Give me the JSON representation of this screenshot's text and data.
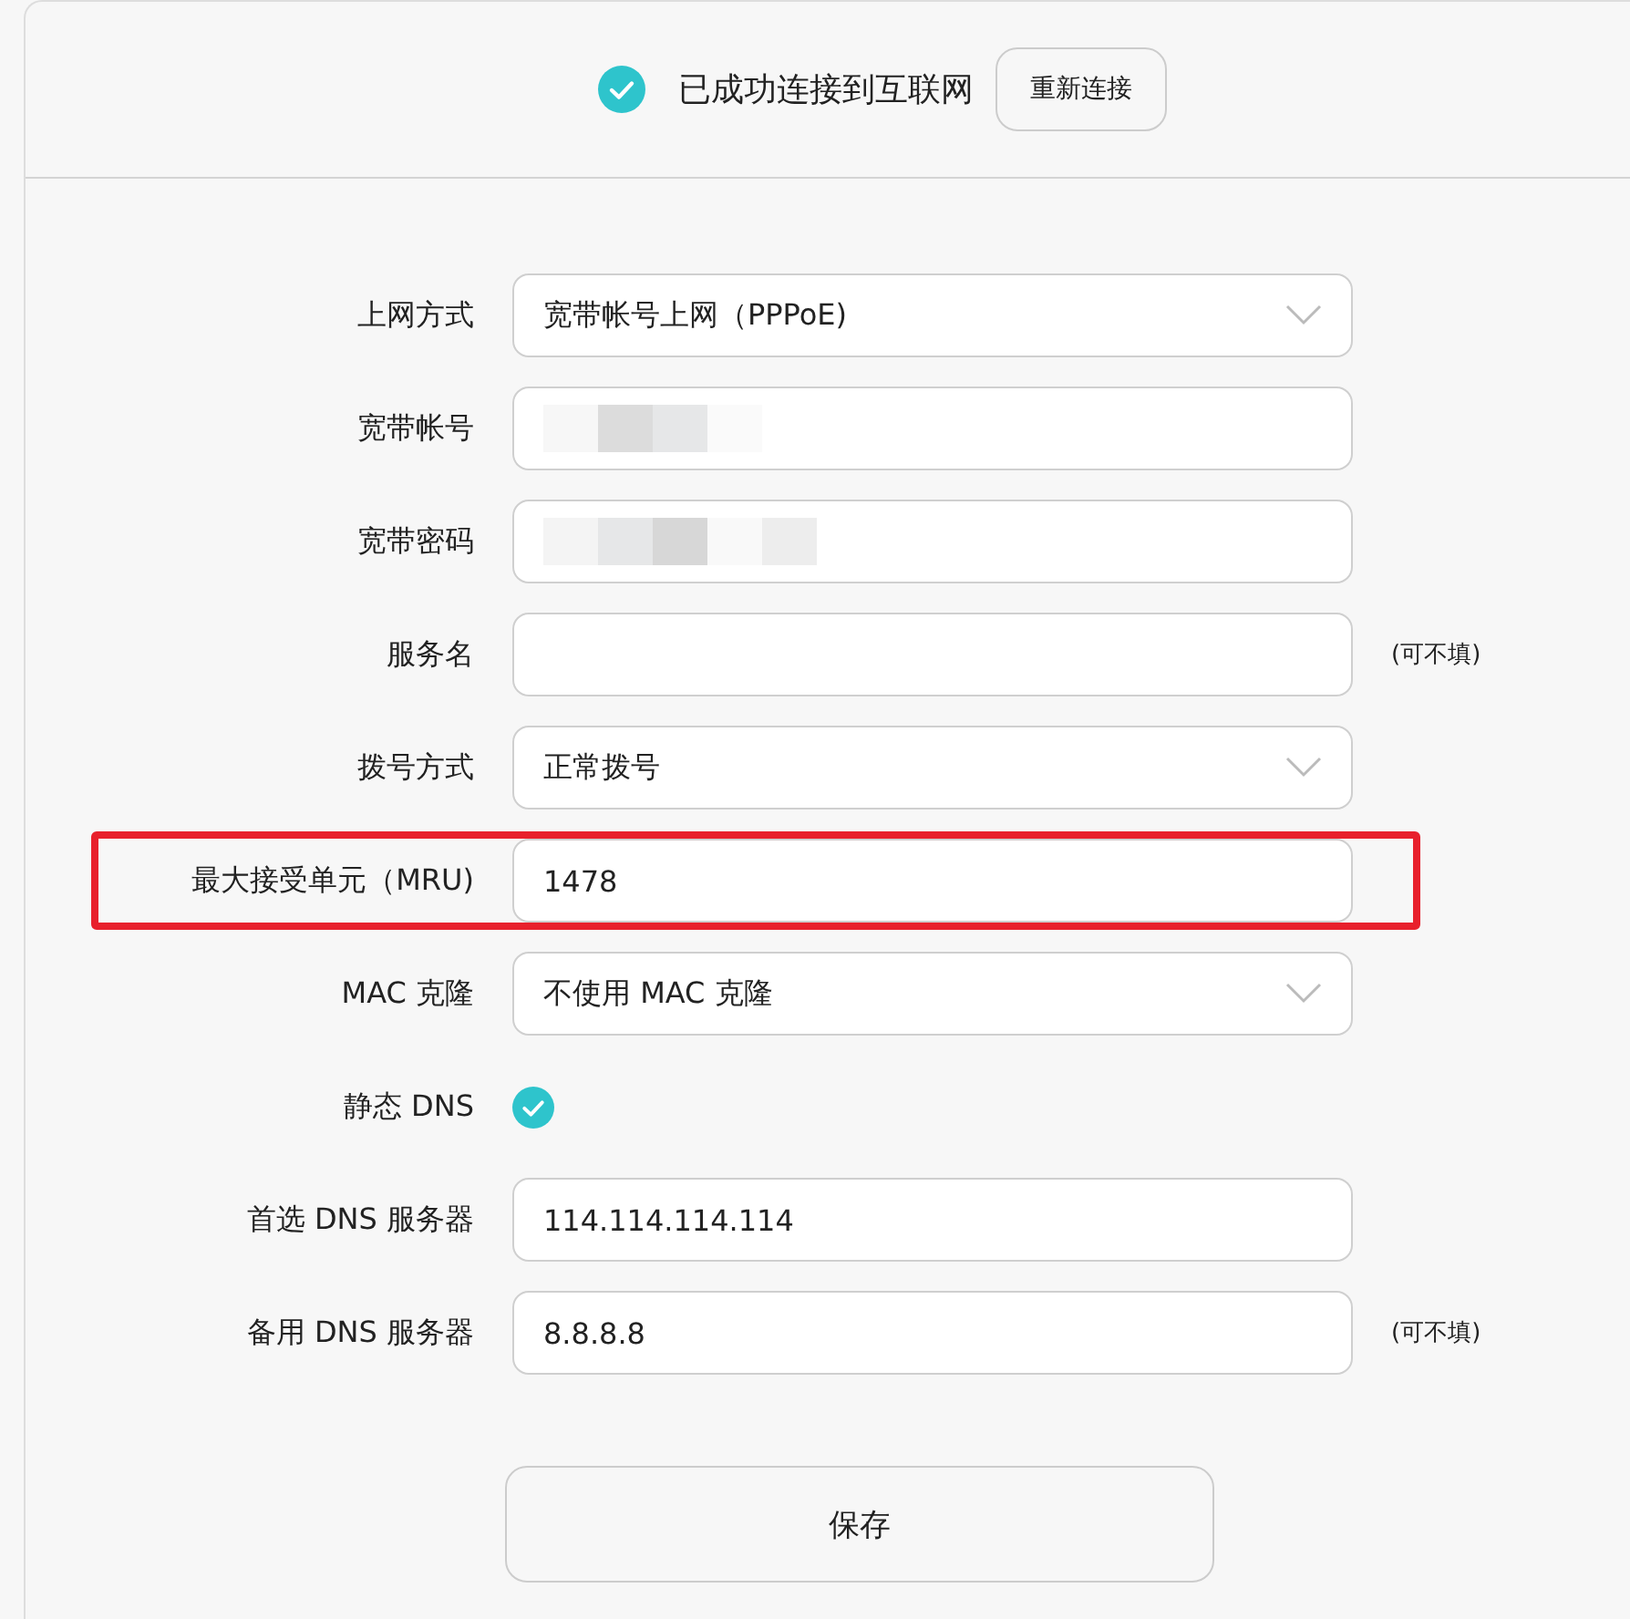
{
  "status": {
    "connected": true,
    "text": "已成功连接到互联网",
    "button": "重新连接"
  },
  "form": [
    {
      "kind": "select",
      "label": "上网方式",
      "value": "宽带帐号上网（PPPoE)",
      "highlighted": false
    },
    {
      "kind": "masked",
      "label": "宽带帐号",
      "highlighted": false
    },
    {
      "kind": "masked",
      "label": "宽带密码",
      "highlighted": false
    },
    {
      "kind": "text",
      "label": "服务名",
      "hint": "(可不填)",
      "highlighted": false
    },
    {
      "kind": "select",
      "label": "拨号方式",
      "value": "正常拨号",
      "highlighted": false
    },
    {
      "kind": "text",
      "label": "最大接受单元（MRU)",
      "value": "1478",
      "highlighted": true
    },
    {
      "kind": "select",
      "label": "MAC 克隆",
      "value": "不使用 MAC 克隆",
      "highlighted": false
    },
    {
      "kind": "check",
      "label": "静态 DNS",
      "checked": true,
      "highlighted": false
    },
    {
      "kind": "text",
      "label": "首选 DNS 服务器",
      "value": "114.114.114.114",
      "highlighted": false
    },
    {
      "kind": "text",
      "label": "备用 DNS 服务器",
      "value": "8.8.8.8",
      "hint": "(可不填)",
      "highlighted": false
    }
  ],
  "save_button": "保存"
}
